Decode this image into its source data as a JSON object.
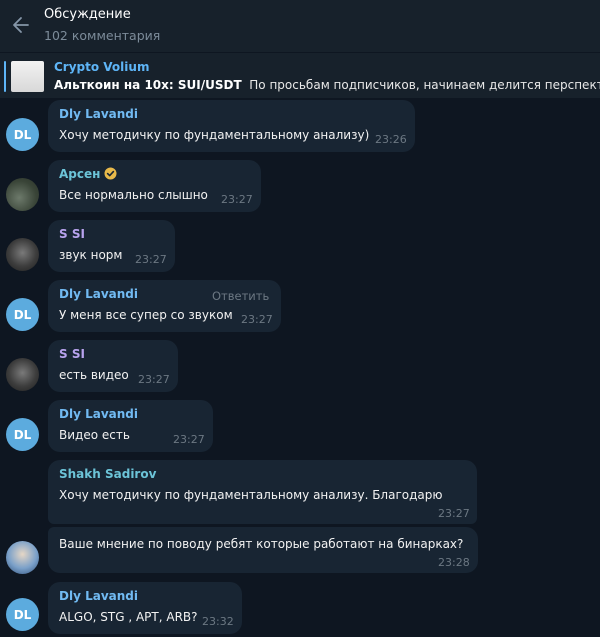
{
  "header": {
    "title": "Обсуждение",
    "subtitle": "102 комментария",
    "back_icon": "arrow-left-icon"
  },
  "pinned": {
    "channel": "Crypto Volium",
    "headline": "Альткоин на 10x: SUI/USDT",
    "preview": "По просьбам подписчиков, начинаем делится перспективными"
  },
  "colors": {
    "background": "#0e1621",
    "bubble": "#182533",
    "header": "#17212b",
    "accent": "#5eb5f7",
    "avatar_dl": "#5cabde"
  },
  "messages": [
    {
      "avatar": "DL",
      "name": "Dly Lavandi",
      "text": "Хочу методичку по фундаментальному анализу)",
      "time": "23:26"
    },
    {
      "avatar": "photo",
      "name": "Арсен",
      "text": "Все нормально слышно",
      "time": "23:27",
      "verified": true
    },
    {
      "avatar": "photo",
      "name": "S SI",
      "text": "звук норм",
      "time": "23:27"
    },
    {
      "avatar": "DL",
      "name": "Dly Lavandi",
      "text": "У меня все супер со звуком",
      "time": "23:27",
      "action": "Ответить"
    },
    {
      "avatar": "photo",
      "name": "S SI",
      "text": "есть видео",
      "time": "23:27"
    },
    {
      "avatar": "DL",
      "name": "Dly Lavandi",
      "text": "Видео есть",
      "time": "23:27"
    },
    {
      "avatar": "photo",
      "name": "Shakh Sadirov",
      "text": "Хочу методичку по фундаментальному анализу. Благодарю",
      "time": "23:27"
    },
    {
      "avatar": "photo",
      "name": "",
      "text": "Ваше мнение по поводу ребят которые работают на бинарках?",
      "time": "23:28"
    },
    {
      "avatar": "DL",
      "name": "Dly Lavandi",
      "text": "ALGO, STG , APT, ARB?",
      "time": "23:32"
    }
  ]
}
